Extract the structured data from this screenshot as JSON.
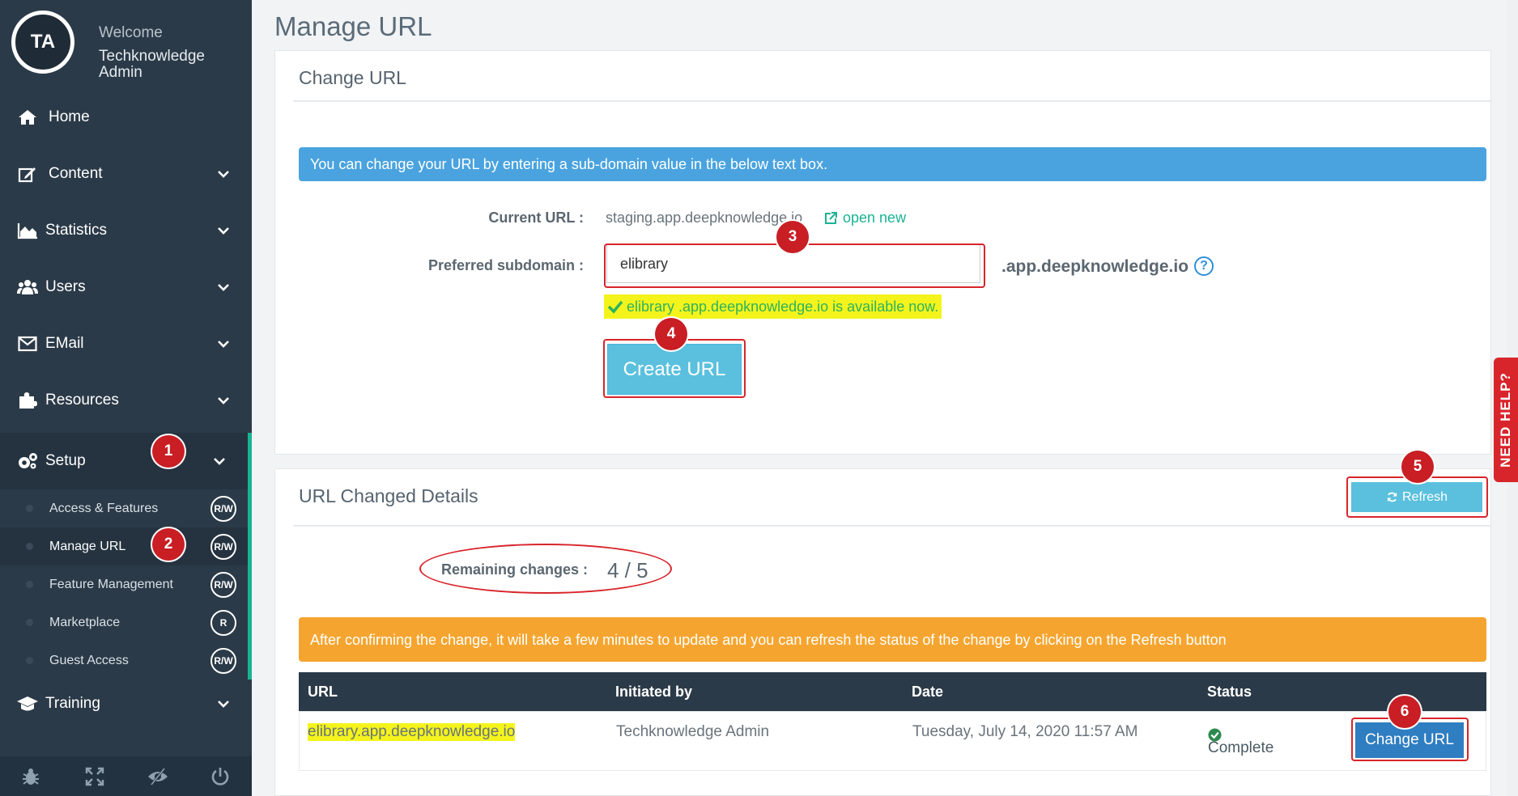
{
  "sidebar": {
    "avatar_initials": "TA",
    "welcome": "Welcome",
    "user_name": "Techknowledge Admin",
    "items": [
      {
        "label": "Home",
        "icon": "home-icon"
      },
      {
        "label": "Content",
        "icon": "edit-icon"
      },
      {
        "label": "Statistics",
        "icon": "area-chart-icon"
      },
      {
        "label": "Users",
        "icon": "users-icon"
      },
      {
        "label": "EMail",
        "icon": "envelope-icon"
      },
      {
        "label": "Resources",
        "icon": "puzzle-icon"
      },
      {
        "label": "Setup",
        "icon": "gears-icon"
      },
      {
        "label": "Training",
        "icon": "graduation-cap-icon"
      }
    ],
    "sub_items": [
      {
        "label": "Access & Features",
        "perm": "R/W"
      },
      {
        "label": "Manage URL",
        "perm": "R/W"
      },
      {
        "label": "Feature Management",
        "perm": "R/W"
      },
      {
        "label": "Marketplace",
        "perm": "R"
      },
      {
        "label": "Guest Access",
        "perm": "R/W"
      }
    ],
    "bottom_icons": [
      "bug-icon",
      "expand-icon",
      "eye-slash-icon",
      "power-icon"
    ]
  },
  "badges": [
    "1",
    "2",
    "3",
    "4",
    "5",
    "6"
  ],
  "page": {
    "title": "Manage URL"
  },
  "change_url": {
    "title": "Change URL",
    "info": "You can change your URL by entering a sub-domain value in the below text box.",
    "current_url_label": "Current URL :",
    "current_url": "staging.app.deepknowledge.io",
    "open_new": "open new",
    "preferred_label": "Preferred subdomain :",
    "preferred_value": "elibrary",
    "domain_suffix": ".app.deepknowledge.io",
    "availability": "elibrary .app.deepknowledge.io is available now.",
    "create_button": "Create URL"
  },
  "details": {
    "title": "URL Changed Details",
    "refresh_button": "Refresh",
    "remaining_label": "Remaining changes :",
    "remaining_value": "4 / 5",
    "info": "After confirming the change, it will take a few minutes to update and you can refresh the status of the change by clicking on the Refresh button",
    "columns": [
      "URL",
      "Initiated by",
      "Date",
      "Status"
    ],
    "rows": [
      {
        "url": "elibrary.app.deepknowledge.io",
        "initiated_by": "Techknowledge Admin",
        "date": "Tuesday, July 14, 2020 11:57 AM",
        "status": "Complete",
        "action": "Change URL"
      }
    ]
  },
  "need_help": "NEED HELP?",
  "colors": {
    "sidebar_bg": "#2b3a48",
    "accent_green": "#1ab394",
    "info_blue": "#4aa3df",
    "info_orange": "#f5a52f",
    "button_cyan": "#5bc0de",
    "button_blue": "#2f7ec1",
    "annotation_red": "#d8252b",
    "highlight_yellow": "#f4f41c"
  }
}
